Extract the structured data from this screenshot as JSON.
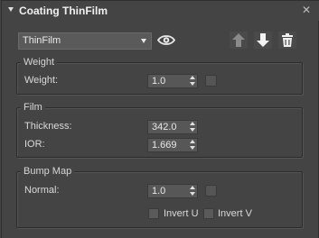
{
  "rollout": {
    "title": "Coating ThinFilm",
    "close_glyph": "✕"
  },
  "toolbar": {
    "preset_value": "ThinFilm",
    "icons": [
      "eye-icon",
      "move-up-icon",
      "move-down-icon",
      "trash-icon"
    ]
  },
  "weight_group": {
    "title": "Weight",
    "weight_label": "Weight:",
    "weight_value": "1.0"
  },
  "film_group": {
    "title": "Film",
    "thickness_label": "Thickness:",
    "thickness_value": "342.0",
    "ior_label": "IOR:",
    "ior_value": "1.669"
  },
  "bump_group": {
    "title": "Bump Map",
    "normal_label": "Normal:",
    "normal_value": "1.0",
    "invert_u_label": "Invert U",
    "invert_v_label": "Invert V"
  },
  "colors": {
    "background": "#444444",
    "text": "#d6d6d6",
    "field": "#575757"
  }
}
